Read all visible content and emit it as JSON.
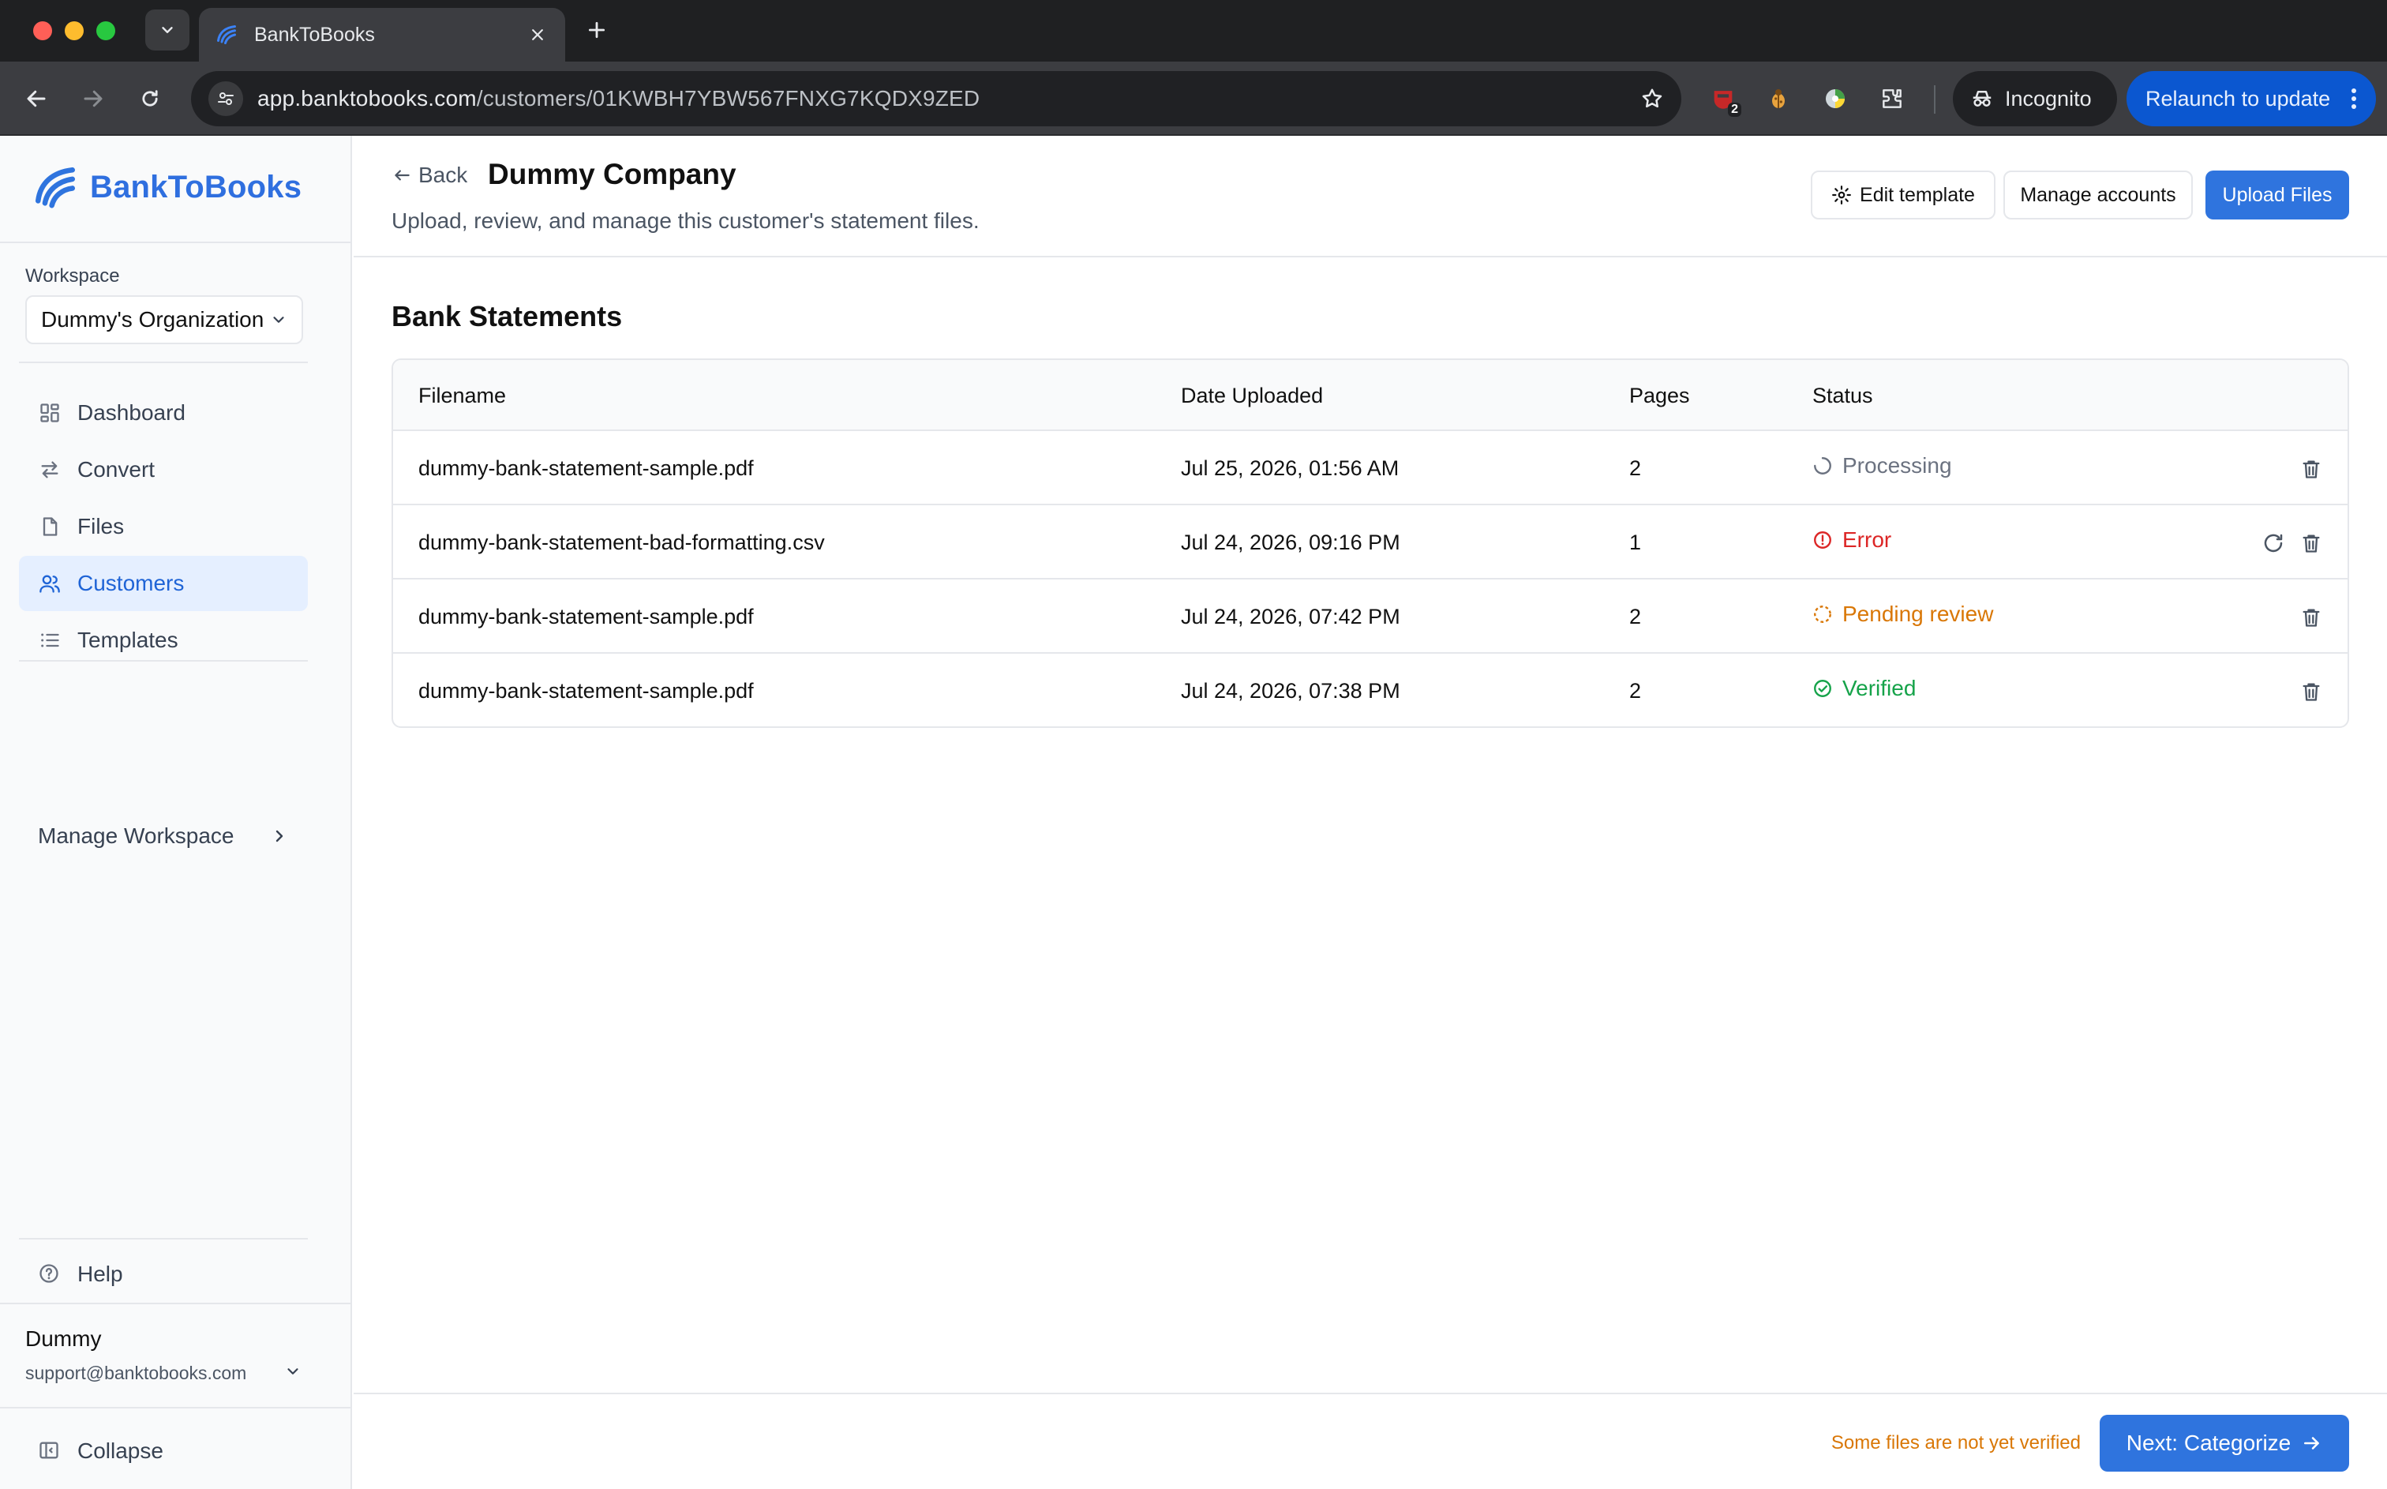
{
  "browser": {
    "tab_title": "BankToBooks",
    "url_host": "app.banktobooks.com",
    "url_path": "/customers/01KWBH7YBW567FNXG7KQDX9ZED",
    "incognito_label": "Incognito",
    "relaunch_label": "Relaunch to update",
    "extension_badge": "2"
  },
  "sidebar": {
    "logo_text": "BankToBooks",
    "workspace_label": "Workspace",
    "workspace_value": "Dummy's Organization",
    "nav": [
      {
        "label": "Dashboard",
        "icon": "dashboard-icon",
        "active": false
      },
      {
        "label": "Convert",
        "icon": "convert-icon",
        "active": false
      },
      {
        "label": "Files",
        "icon": "file-icon",
        "active": false
      },
      {
        "label": "Customers",
        "icon": "users-icon",
        "active": true
      },
      {
        "label": "Templates",
        "icon": "list-icon",
        "active": false
      }
    ],
    "manage_workspace": "Manage Workspace",
    "help": "Help",
    "user_name": "Dummy",
    "user_email": "support@banktobooks.com",
    "collapse": "Collapse"
  },
  "header": {
    "back_label": "Back",
    "title": "Dummy Company",
    "subtitle": "Upload, review, and manage this customer's statement files.",
    "edit_template": "Edit template",
    "manage_accounts": "Manage accounts",
    "upload_files": "Upload Files"
  },
  "statements": {
    "title": "Bank Statements",
    "columns": [
      "Filename",
      "Date Uploaded",
      "Pages",
      "Status"
    ],
    "rows": [
      {
        "filename": "dummy-bank-statement-sample.pdf",
        "date": "Jul 25, 2026, 01:56 AM",
        "pages": "2",
        "status": "Processing"
      },
      {
        "filename": "dummy-bank-statement-bad-formatting.csv",
        "date": "Jul 24, 2026, 09:16 PM",
        "pages": "1",
        "status": "Error"
      },
      {
        "filename": "dummy-bank-statement-sample.pdf",
        "date": "Jul 24, 2026, 07:42 PM",
        "pages": "2",
        "status": "Pending review"
      },
      {
        "filename": "dummy-bank-statement-sample.pdf",
        "date": "Jul 24, 2026, 07:38 PM",
        "pages": "2",
        "status": "Verified"
      }
    ]
  },
  "footer": {
    "warning": "Some files are not yet verified",
    "next_label": "Next: Categorize"
  },
  "colors": {
    "brand": "#2f74de",
    "processing": "#6b7280",
    "error": "#dc2626",
    "pending": "#d97706",
    "verified": "#16a34a"
  }
}
